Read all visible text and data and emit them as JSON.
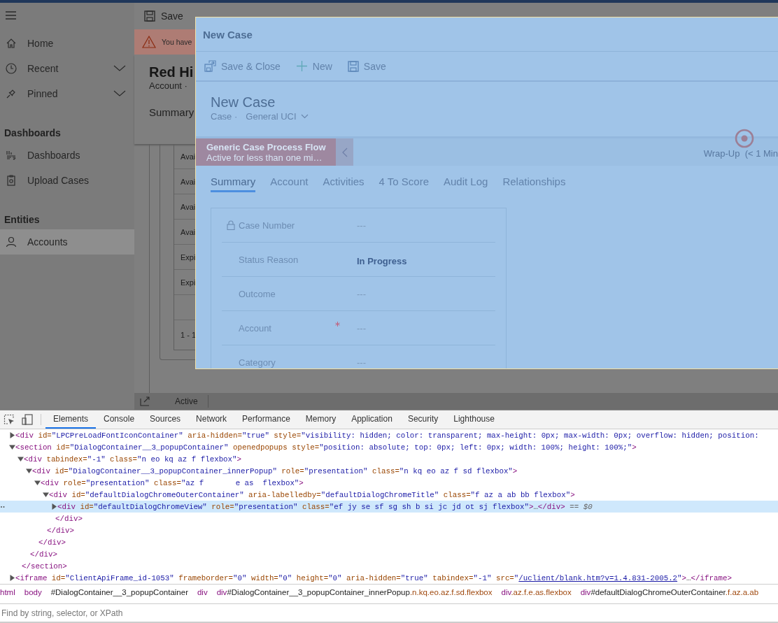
{
  "app": {
    "sidebar": {
      "items": [
        {
          "kind": "item",
          "label": "Home",
          "expandable": false,
          "selected": false
        },
        {
          "kind": "item",
          "label": "Recent",
          "expandable": true,
          "selected": false
        },
        {
          "kind": "item",
          "label": "Pinned",
          "expandable": true,
          "selected": false
        },
        {
          "kind": "heading",
          "label": "Dashboards"
        },
        {
          "kind": "item",
          "label": "Dashboards",
          "expandable": false,
          "selected": false
        },
        {
          "kind": "item",
          "label": "Upload Cases",
          "expandable": false,
          "selected": false
        },
        {
          "kind": "heading",
          "label": "Entities"
        },
        {
          "kind": "item",
          "label": "Accounts",
          "expandable": false,
          "selected": true
        }
      ]
    },
    "toolbar": {
      "save": "Save"
    },
    "warning": "You have",
    "record": {
      "title": "Red Hi",
      "subtitle": "Account ·",
      "tab": "Summary"
    },
    "grid_rows": [
      {
        "kind": "row",
        "text": "Avai"
      },
      {
        "kind": "row",
        "text": "Avai"
      },
      {
        "kind": "row",
        "text": "Avai"
      },
      {
        "kind": "row",
        "text": "Avai"
      },
      {
        "kind": "row",
        "text": "Expi"
      },
      {
        "kind": "row",
        "text": "Expi"
      },
      {
        "kind": "blank"
      },
      {
        "kind": "footer",
        "text": "1 - 1"
      }
    ],
    "status_bar": {
      "status": "Active"
    }
  },
  "dialog": {
    "title": "New Case",
    "commands": [
      {
        "label": "Save & Close"
      },
      {
        "label": "New"
      },
      {
        "label": "Save"
      }
    ],
    "record_title": "New Case",
    "entity": "Case ·",
    "form_selector": "General UCI",
    "process": {
      "name": "Generic Case Process Flow",
      "duration": "Active for less than one mi…",
      "stage": "Wrap-Up  (< 1 Min"
    },
    "tabs": [
      {
        "label": "Summary",
        "selected": true
      },
      {
        "label": "Account",
        "selected": false
      },
      {
        "label": "Activities",
        "selected": false
      },
      {
        "label": "4 To Score",
        "selected": false
      },
      {
        "label": "Audit Log",
        "selected": false
      },
      {
        "label": "Relationships",
        "selected": false
      }
    ],
    "fields": [
      {
        "label": "Case Number",
        "value": "---",
        "locked": true,
        "required": false,
        "empty": true
      },
      {
        "label": "Status Reason",
        "value": "In Progress",
        "locked": false,
        "required": false,
        "empty": false
      },
      {
        "label": "Outcome",
        "value": "---",
        "locked": false,
        "required": false,
        "empty": true
      },
      {
        "label": "Account",
        "value": "---",
        "locked": false,
        "required": true,
        "empty": true
      },
      {
        "label": "Category",
        "value": "---",
        "locked": false,
        "required": false,
        "empty": true
      }
    ]
  },
  "devtools": {
    "tabs": [
      {
        "label": "Elements",
        "selected": true
      },
      {
        "label": "Console",
        "selected": false
      },
      {
        "label": "Sources",
        "selected": false
      },
      {
        "label": "Network",
        "selected": false
      },
      {
        "label": "Performance",
        "selected": false
      },
      {
        "label": "Memory",
        "selected": false
      },
      {
        "label": "Application",
        "selected": false
      },
      {
        "label": "Security",
        "selected": false
      },
      {
        "label": "Lighthouse",
        "selected": false
      }
    ],
    "dom_tree": [
      {
        "expanded": false,
        "selected": false,
        "open": [
          {
            "kind": "tag",
            "text": "<div"
          },
          {
            "kind": "attr",
            "text": " id="
          },
          {
            "kind": "value",
            "text": "\"LPCPreLoadFontIconContainer\""
          },
          {
            "kind": "attr",
            "text": " aria-hidden="
          },
          {
            "kind": "value",
            "text": "\"true\""
          },
          {
            "kind": "attr",
            "text": " style="
          },
          {
            "kind": "value",
            "text": "\"visibility: hidden; color: transparent; max-height: 0px; max-width: 0px; overflow: hidden; position:"
          }
        ]
      },
      {
        "expanded": true,
        "selected": false,
        "open": [
          {
            "kind": "tag",
            "text": "<section"
          },
          {
            "kind": "attr",
            "text": " id="
          },
          {
            "kind": "value",
            "text": "\"DialogContainer__3_popupContainer\""
          },
          {
            "kind": "attr",
            "text": " openedpopups style="
          },
          {
            "kind": "value",
            "text": "\"position: absolute; top: 0px; left: 0px; width: 100%; height: 100%;\""
          },
          {
            "kind": "tag",
            "text": ">"
          }
        ],
        "close": "</section>",
        "children": [
          {
            "expanded": true,
            "selected": false,
            "open": [
              {
                "kind": "tag",
                "text": "<div"
              },
              {
                "kind": "attr",
                "text": " tabindex="
              },
              {
                "kind": "value",
                "text": "\"-1\""
              },
              {
                "kind": "attr",
                "text": " class="
              },
              {
                "kind": "value",
                "text": "\"n eo kq az f flexbox\""
              },
              {
                "kind": "tag",
                "text": ">"
              }
            ],
            "close": "</div>",
            "children": [
              {
                "expanded": true,
                "selected": false,
                "open": [
                  {
                    "kind": "tag",
                    "text": "<div"
                  },
                  {
                    "kind": "attr",
                    "text": " id="
                  },
                  {
                    "kind": "value",
                    "text": "\"DialogContainer__3_popupContainer_innerPopup\""
                  },
                  {
                    "kind": "attr",
                    "text": " role="
                  },
                  {
                    "kind": "value",
                    "text": "\"presentation\""
                  },
                  {
                    "kind": "attr",
                    "text": " class="
                  },
                  {
                    "kind": "value",
                    "text": "\"n kq eo az f sd flexbox\""
                  },
                  {
                    "kind": "tag",
                    "text": ">"
                  }
                ],
                "close": "</div>",
                "children": [
                  {
                    "expanded": true,
                    "selected": false,
                    "open": [
                      {
                        "kind": "tag",
                        "text": "<div"
                      },
                      {
                        "kind": "attr",
                        "text": " role="
                      },
                      {
                        "kind": "value",
                        "text": "\"presentation\""
                      },
                      {
                        "kind": "attr",
                        "text": " class="
                      },
                      {
                        "kind": "value",
                        "text": "\"az f       e as  flexbox\""
                      },
                      {
                        "kind": "tag",
                        "text": ">"
                      }
                    ],
                    "close": "</div>",
                    "children": [
                      {
                        "expanded": true,
                        "selected": false,
                        "open": [
                          {
                            "kind": "tag",
                            "text": "<div"
                          },
                          {
                            "kind": "attr",
                            "text": " id="
                          },
                          {
                            "kind": "value",
                            "text": "\"defaultDialogChromeOuterContainer\""
                          },
                          {
                            "kind": "attr",
                            "text": " aria-labelledby="
                          },
                          {
                            "kind": "value",
                            "text": "\"defaultDialogChromeTitle\""
                          },
                          {
                            "kind": "attr",
                            "text": " class="
                          },
                          {
                            "kind": "value",
                            "text": "\"f az a ab bb flexbox\""
                          },
                          {
                            "kind": "tag",
                            "text": ">"
                          }
                        ],
                        "close": "</div>",
                        "children": [
                          {
                            "expanded": false,
                            "selected": true,
                            "open": [
                              {
                                "kind": "tag",
                                "text": "<div"
                              },
                              {
                                "kind": "attr",
                                "text": " id="
                              },
                              {
                                "kind": "value",
                                "text": "\"defaultDialogChromeView\""
                              },
                              {
                                "kind": "attr",
                                "text": " role="
                              },
                              {
                                "kind": "value",
                                "text": "\"presentation\""
                              },
                              {
                                "kind": "attr",
                                "text": " class="
                              },
                              {
                                "kind": "value",
                                "text": "\"ef jy se sf sg sh b si jc jd ot sj flexbox\""
                              },
                              {
                                "kind": "tag",
                                "text": ">"
                              },
                              {
                                "kind": "plain",
                                "text": "…"
                              },
                              {
                                "kind": "tag",
                                "text": "</div>"
                              },
                              {
                                "kind": "note",
                                "text": " == $0"
                              }
                            ]
                          }
                        ]
                      }
                    ]
                  }
                ]
              }
            ]
          }
        ]
      },
      {
        "expanded": false,
        "selected": false,
        "open": [
          {
            "kind": "tag",
            "text": "<iframe"
          },
          {
            "kind": "attr",
            "text": " id="
          },
          {
            "kind": "value",
            "text": "\"ClientApiFrame_id-1053\""
          },
          {
            "kind": "attr",
            "text": " frameborder="
          },
          {
            "kind": "value",
            "text": "\"0\""
          },
          {
            "kind": "attr",
            "text": " width="
          },
          {
            "kind": "value",
            "text": "\"0\""
          },
          {
            "kind": "attr",
            "text": " height="
          },
          {
            "kind": "value",
            "text": "\"0\""
          },
          {
            "kind": "attr",
            "text": " aria-hidden="
          },
          {
            "kind": "value",
            "text": "\"true\""
          },
          {
            "kind": "attr",
            "text": " tabindex="
          },
          {
            "kind": "value",
            "text": "\"-1\""
          },
          {
            "kind": "attr",
            "text": " src="
          },
          {
            "kind": "value",
            "text": "\""
          },
          {
            "kind": "link",
            "text": "/uclient/blank.htm?v=1.4.831-2005.2"
          },
          {
            "kind": "value",
            "text": "\""
          },
          {
            "kind": "tag",
            "text": ">"
          },
          {
            "kind": "plain",
            "text": "…"
          },
          {
            "kind": "tag",
            "text": "</iframe>"
          }
        ]
      }
    ],
    "breadcrumbs": [
      [
        {
          "kind": "tag",
          "text": "html"
        }
      ],
      [
        {
          "kind": "tag",
          "text": "body"
        }
      ],
      [
        {
          "kind": "id",
          "text": "#DialogContainer__3_popupContainer"
        }
      ],
      [
        {
          "kind": "tag",
          "text": "div"
        }
      ],
      [
        {
          "kind": "tag",
          "text": "div"
        },
        {
          "kind": "id",
          "text": "#DialogContainer__3_popupContainer_innerPopup"
        },
        {
          "kind": "class",
          "text": ".n.kq.eo.az.f.sd.flexbox"
        }
      ],
      [
        {
          "kind": "tag",
          "text": "div"
        },
        {
          "kind": "class",
          "text": ".az.f.e.as.flexbox"
        }
      ],
      [
        {
          "kind": "tag",
          "text": "div"
        },
        {
          "kind": "id",
          "text": "#defaultDialogChromeOuterContainer"
        },
        {
          "kind": "class",
          "text": ".f.az.a.ab"
        }
      ]
    ],
    "find": {
      "placeholder": "Find by string, selector, or XPath"
    }
  }
}
